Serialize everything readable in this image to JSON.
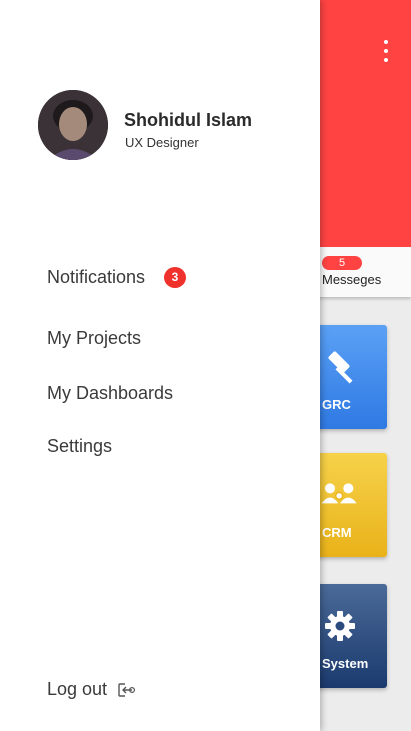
{
  "background": {
    "header_color": "#ff4343",
    "messages": {
      "count": "5",
      "label": "Messeges"
    },
    "cards": [
      {
        "label": "GRC",
        "icon": "gavel-icon",
        "color": "#2f79e3"
      },
      {
        "label": "CRM",
        "icon": "people-icon",
        "color": "#e9b21a"
      },
      {
        "label": "System",
        "icon": "gear-icon",
        "color": "#1b3a6e"
      }
    ]
  },
  "drawer": {
    "profile": {
      "name": "Shohidul Islam",
      "role": "UX Designer"
    },
    "menu": [
      {
        "label": "Notifications",
        "badge": "3"
      },
      {
        "label": "My Projects"
      },
      {
        "label": "My Dashboards"
      },
      {
        "label": "Settings"
      }
    ],
    "logout": {
      "label": "Log out",
      "icon": "logout-icon"
    }
  }
}
